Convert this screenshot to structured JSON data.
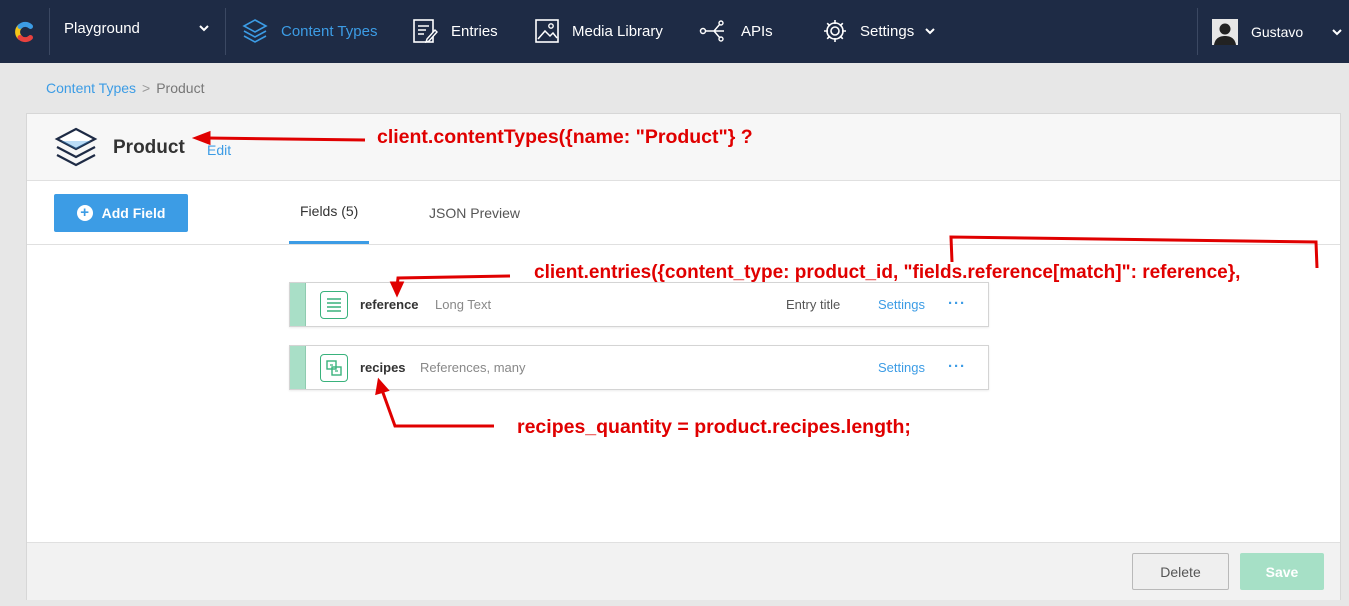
{
  "nav": {
    "space": "Playground",
    "items": [
      {
        "label": "Content Types",
        "icon": "layers-icon",
        "active": true
      },
      {
        "label": "Entries",
        "icon": "entries-icon"
      },
      {
        "label": "Media Library",
        "icon": "image-icon"
      },
      {
        "label": "APIs",
        "icon": "apis-icon"
      },
      {
        "label": "Settings",
        "icon": "gear-icon"
      }
    ],
    "user": "Gustavo"
  },
  "breadcrumb": {
    "root": "Content Types",
    "sep": ">",
    "current": "Product"
  },
  "content_type": {
    "title": "Product",
    "edit_label": "Edit"
  },
  "toolbar": {
    "add_field": "Add Field",
    "tabs": [
      "Fields (5)",
      "JSON Preview"
    ]
  },
  "fields": [
    {
      "name": "reference",
      "type": "Long Text",
      "title_badge": "Entry title",
      "settings": "Settings",
      "more": "···"
    },
    {
      "name": "recipes",
      "type": "References, many",
      "settings": "Settings",
      "more": "···"
    }
  ],
  "footer": {
    "delete": "Delete",
    "save": "Save"
  },
  "annotations": {
    "a1": "client.contentTypes({name: \"Product\"} ?",
    "a2": "client.entries({content_type: product_id, \"fields.reference[match]\": reference},",
    "a3": "recipes_quantity = product.recipes.length;"
  },
  "colors": {
    "nav_bg": "#1e2b45",
    "accent": "#3c9ce5",
    "field_grip": "#a9dfc7",
    "annotation": "#e00000",
    "save_disabled": "#a6e0c6"
  }
}
